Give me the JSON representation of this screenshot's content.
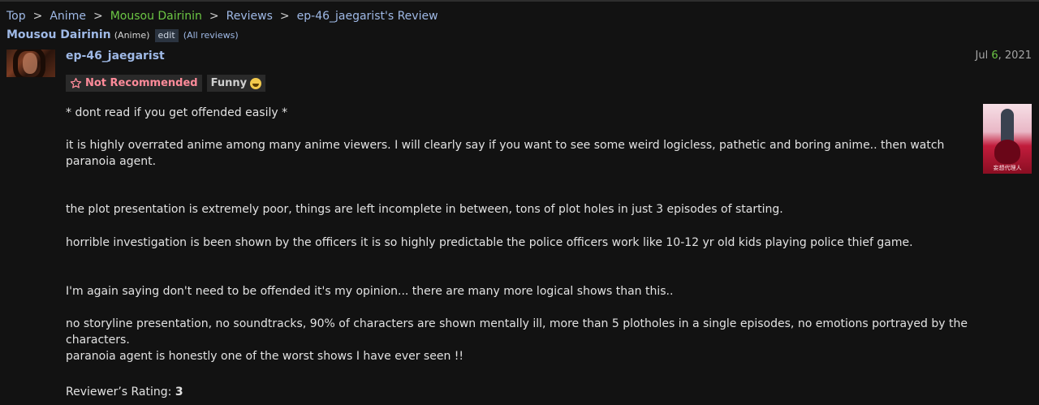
{
  "breadcrumb": {
    "items": [
      "Top",
      "Anime",
      "Mousou Dairinin",
      "Reviews",
      "ep-46_jaegarist's Review"
    ],
    "separator": ">"
  },
  "title_bar": {
    "anime_title": "Mousou Dairinin",
    "type": "(Anime)",
    "edit_label": "edit",
    "all_reviews_label": "(All reviews)"
  },
  "review": {
    "username": "ep-46_jaegarist",
    "date": {
      "month": "Jul",
      "day": "6",
      "year": ", 2021"
    },
    "tags": {
      "not_recommended": "Not Recommended",
      "funny": "Funny"
    },
    "paragraphs": [
      "* dont read if you get offended easily *",
      "it is highly overrated anime among many anime viewers. I will clearly say if you want to see some weird logicless, pathetic and boring anime.. then watch paranoia agent.",
      "the plot presentation is extremely poor, things are left incomplete in between, tons of plot holes in just 3 episodes of starting.",
      "horrible investigation is been shown by the officers it is so highly predictable the police officers work like 10-12 yr old kids playing police thief game.",
      "I'm again saying don't need to be offended it's my opinion... there are many more logical shows than this..",
      "no storyline presentation, no soundtracks, 90% of characters are shown mentally ill, more than 5 plotholes in a single episodes, no emotions portrayed by the characters.",
      "paranoia agent is honestly one of the worst shows I have ever seen !!"
    ],
    "rating_label": "Reviewer’s Rating:",
    "rating_value": "3",
    "cover_text": "妄想代理人"
  },
  "colors": {
    "background": "#121212",
    "link": "#9fb9e6",
    "highlight_green": "#6cc644",
    "not_recommended": "#ff8b9a"
  },
  "icons": {
    "not_recommended": "star-outline-icon",
    "funny": "laughing-face-icon"
  }
}
